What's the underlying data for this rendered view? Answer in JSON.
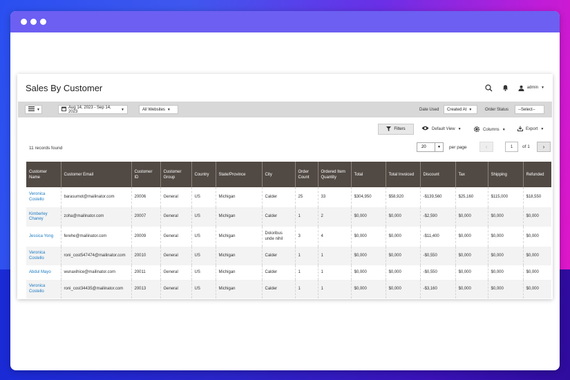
{
  "page": {
    "title": "Sales By Customer",
    "user": "admin",
    "colors": {
      "header_bg": "#514943",
      "link": "#1979c3",
      "browser_bar": "#6c5ff2"
    }
  },
  "icons": {
    "search": "search-icon",
    "bell": "bell-icon",
    "user": "user-icon"
  },
  "toolbar": {
    "date_range": "Aug 14, 2023 - Sep 14, 2023",
    "website": "All Websites",
    "date_used_label": "Date Used",
    "date_used_value": "Created At",
    "order_status_label": "Order Status",
    "order_status_value": "--Select--"
  },
  "actions": {
    "filters": "Filters",
    "default_view": "Default View",
    "columns": "Columns",
    "export": "Export"
  },
  "pager": {
    "records": "11 records found",
    "per_page_value": "20",
    "per_page_label": "per page",
    "current_page": "1",
    "of_label": "of 1"
  },
  "table": {
    "columns": [
      "Customer Name",
      "Customer Email",
      "Customer ID",
      "Customer Group",
      "Country",
      "State/Province",
      "City",
      "Order Count",
      "Ordered Item Quantity",
      "Total",
      "Total Invoiced",
      "Discount",
      "Tax",
      "Shipping",
      "Refunded"
    ],
    "rows": [
      [
        "Veronica Costello",
        "barasumot@mailinator.com",
        "20006",
        "General",
        "US",
        "Michigan",
        "Calder",
        "25",
        "33",
        "$304,950",
        "$58,920",
        "-$139,560",
        "$25,160",
        "$115,000",
        "$18,550"
      ],
      [
        "Kimberley Chaney",
        "zoha@mailinator.com",
        "20007",
        "General",
        "US",
        "Michigan",
        "Calder",
        "1",
        "2",
        "$0,000",
        "$0,000",
        "-$2,590",
        "$0,000",
        "$0,000",
        "$0,000"
      ],
      [
        "Jessica Yong",
        "ferehe@mailinator.com",
        "20009",
        "General",
        "US",
        "Michigan",
        "Doloribus unde nihil",
        "3",
        "4",
        "$0,000",
        "$0,000",
        "-$11,400",
        "$0,000",
        "$0,000",
        "$0,000"
      ],
      [
        "Veronica Costello",
        "roni_cost547474@mailinator.com",
        "20010",
        "General",
        "US",
        "Michigan",
        "Calder",
        "1",
        "1",
        "$0,000",
        "$0,000",
        "-$0,550",
        "$0,000",
        "$0,000",
        "$0,000"
      ],
      [
        "Abdul Mayo",
        "wunaxihice@mailinator.com",
        "20011",
        "General",
        "US",
        "Michigan",
        "Calder",
        "1",
        "1",
        "$0,000",
        "$0,000",
        "-$0,550",
        "$0,000",
        "$0,000",
        "$0,000"
      ],
      [
        "Veronica Costello",
        "roni_cost34435@mailinator.com",
        "20013",
        "General",
        "US",
        "Michigan",
        "Calder",
        "1",
        "1",
        "$0,000",
        "$0,000",
        "-$3,160",
        "$0,000",
        "$0,000",
        "$0,000"
      ]
    ]
  }
}
